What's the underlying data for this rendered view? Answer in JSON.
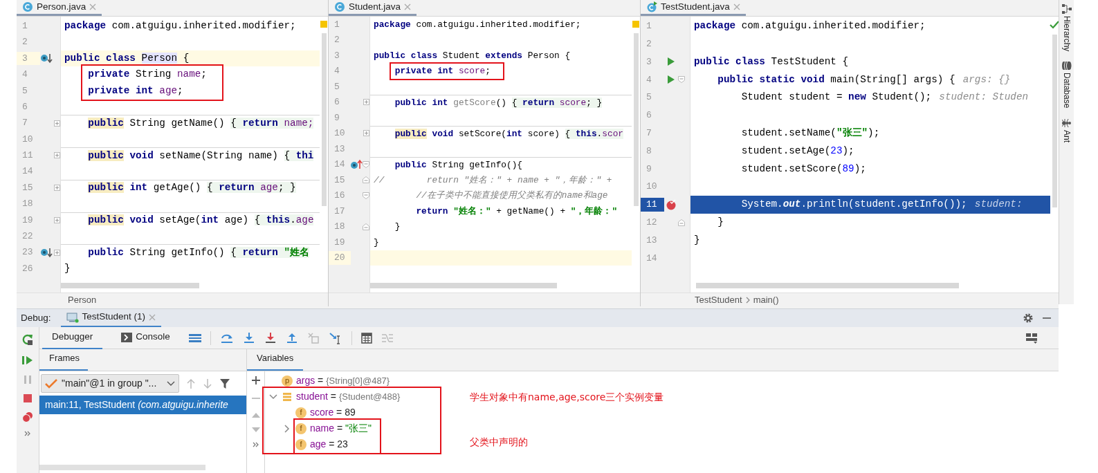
{
  "editors": [
    {
      "tab": {
        "label": "Person.java",
        "kind": "class",
        "selected": true
      },
      "warnings": true,
      "breadcrumbs": [
        "Person"
      ],
      "lines": [
        {
          "number": "1",
          "tokens": [
            {
              "kind": "keyword",
              "text": "package"
            },
            {
              "kind": "plain",
              "text": " com.atguigu.inherited.modifier;"
            }
          ]
        },
        {
          "number": "2"
        },
        {
          "number": "3",
          "current": true,
          "overridden": true,
          "tokens": [
            {
              "kind": "keyword",
              "text": "public class "
            },
            {
              "kind": "plain",
              "text": "Person",
              "identifier": true
            },
            {
              "kind": "plain",
              "text": " {"
            }
          ]
        },
        {
          "number": "4",
          "boxed": true,
          "tokens": [
            {
              "kind": "keyword",
              "text": "    private "
            },
            {
              "kind": "plain",
              "text": "String "
            },
            {
              "kind": "field",
              "text": "name"
            },
            {
              "kind": "plain",
              "text": ";"
            }
          ]
        },
        {
          "number": "5",
          "boxed": true,
          "tokens": [
            {
              "kind": "keyword",
              "text": "    private int "
            },
            {
              "kind": "field",
              "text": "age"
            },
            {
              "kind": "plain",
              "text": ";"
            }
          ]
        },
        {
          "number": "6"
        },
        {
          "number": "7",
          "separator": true,
          "collapsed": true,
          "tokens": [
            {
              "kind": "keyword",
              "text": "    public",
              "usage": true
            },
            {
              "kind": "plain",
              "text": " String getName() "
            },
            {
              "kind": "plain",
              "text": "{ ",
              "folded": true
            },
            {
              "kind": "keyword",
              "text": "return ",
              "folded": true
            },
            {
              "kind": "field",
              "text": "name;",
              "folded": true
            }
          ]
        },
        {
          "number": "10"
        },
        {
          "number": "11",
          "separator": true,
          "collapsed": true,
          "tokens": [
            {
              "kind": "keyword",
              "text": "    public",
              "usage": true
            },
            {
              "kind": "keyword",
              "text": " void"
            },
            {
              "kind": "plain",
              "text": " setName(String name) "
            },
            {
              "kind": "plain",
              "text": "{ ",
              "folded": true
            },
            {
              "kind": "keyword",
              "text": "thi",
              "folded": true
            }
          ]
        },
        {
          "number": "14"
        },
        {
          "number": "15",
          "separator": true,
          "collapsed": true,
          "tokens": [
            {
              "kind": "keyword",
              "text": "    public",
              "usage": true
            },
            {
              "kind": "keyword",
              "text": " int"
            },
            {
              "kind": "plain",
              "text": " getAge() "
            },
            {
              "kind": "plain",
              "text": "{ ",
              "folded": true
            },
            {
              "kind": "keyword",
              "text": "return ",
              "folded": true
            },
            {
              "kind": "field",
              "text": "age",
              "folded": true
            },
            {
              "kind": "plain",
              "text": "; }",
              "folded": true
            }
          ]
        },
        {
          "number": "18"
        },
        {
          "number": "19",
          "separator": true,
          "collapsed": true,
          "tokens": [
            {
              "kind": "keyword",
              "text": "    public",
              "usage": true
            },
            {
              "kind": "keyword",
              "text": " void"
            },
            {
              "kind": "plain",
              "text": " setAge("
            },
            {
              "kind": "keyword",
              "text": "int"
            },
            {
              "kind": "plain",
              "text": " age) "
            },
            {
              "kind": "plain",
              "text": "{ ",
              "folded": true
            },
            {
              "kind": "keyword",
              "text": "this",
              "folded": true
            },
            {
              "kind": "plain",
              "text": ".",
              "folded": true
            },
            {
              "kind": "field",
              "text": "age",
              "folded": true
            }
          ]
        },
        {
          "number": "22"
        },
        {
          "number": "23",
          "separator": true,
          "collapsed": true,
          "overridden": true,
          "tokens": [
            {
              "kind": "keyword",
              "text": "    public"
            },
            {
              "kind": "plain",
              "text": " String getInfo() "
            },
            {
              "kind": "plain",
              "text": "{ ",
              "folded": true
            },
            {
              "kind": "keyword",
              "text": "return ",
              "folded": true
            },
            {
              "kind": "string",
              "text": "\"姓名",
              "folded": true
            }
          ]
        },
        {
          "number": "26",
          "tokens": [
            {
              "kind": "plain",
              "text": "}"
            }
          ]
        }
      ]
    },
    {
      "tab": {
        "label": "Student.java",
        "kind": "class",
        "selected": true
      },
      "warnings": true,
      "lines": [
        {
          "number": "1",
          "tokens": [
            {
              "kind": "keyword",
              "text": "package"
            },
            {
              "kind": "plain",
              "text": " com.atguigu.inherited.modifier;"
            }
          ]
        },
        {
          "number": "2"
        },
        {
          "number": "3",
          "tokens": [
            {
              "kind": "keyword",
              "text": "public class "
            },
            {
              "kind": "plain",
              "text": "Student "
            },
            {
              "kind": "keyword",
              "text": "extends "
            },
            {
              "kind": "plain",
              "text": "Person {"
            }
          ]
        },
        {
          "number": "4",
          "boxed": true,
          "tokens": [
            {
              "kind": "keyword",
              "text": "    private int "
            },
            {
              "kind": "field",
              "text": "score"
            },
            {
              "kind": "plain",
              "text": ";"
            }
          ]
        },
        {
          "number": "5"
        },
        {
          "number": "6",
          "separator": true,
          "collapsed": true,
          "tokens": [
            {
              "kind": "keyword",
              "text": "    public int "
            },
            {
              "kind": "unused",
              "text": "getScore"
            },
            {
              "kind": "plain",
              "text": "() "
            },
            {
              "kind": "plain",
              "text": "{ ",
              "folded": true
            },
            {
              "kind": "keyword",
              "text": "return ",
              "folded": true
            },
            {
              "kind": "field",
              "text": "score",
              "folded": true
            },
            {
              "kind": "plain",
              "text": "; }",
              "folded": true
            }
          ]
        },
        {
          "number": "9"
        },
        {
          "number": "10",
          "separator": true,
          "collapsed": true,
          "tokens": [
            {
              "kind": "keyword",
              "text": "    public",
              "usage": true
            },
            {
              "kind": "keyword",
              "text": " void "
            },
            {
              "kind": "plain",
              "text": "setScore("
            },
            {
              "kind": "keyword",
              "text": "int"
            },
            {
              "kind": "plain",
              "text": " score) "
            },
            {
              "kind": "plain",
              "text": "{ ",
              "folded": true
            },
            {
              "kind": "keyword",
              "text": "this",
              "folded": true
            },
            {
              "kind": "plain",
              "text": ".",
              "folded": true
            },
            {
              "kind": "field",
              "text": "scor",
              "folded": true
            }
          ]
        },
        {
          "number": "13"
        },
        {
          "number": "14",
          "separator": true,
          "fold_start": true,
          "overrides": true,
          "tokens": [
            {
              "kind": "keyword",
              "text": "    public "
            },
            {
              "kind": "plain",
              "text": "String getInfo(){"
            }
          ]
        },
        {
          "number": "15",
          "fold_end": true,
          "tokens": [
            {
              "kind": "comment",
              "text": "//        return \"姓名：\" + name + \"，年龄：\" +"
            }
          ]
        },
        {
          "number": "16",
          "fold_start": true,
          "tokens": [
            {
              "kind": "comment",
              "text": "        //在子类中不能直接使用父类私有的name和age"
            }
          ]
        },
        {
          "number": "17",
          "tokens": [
            {
              "kind": "keyword",
              "text": "        return "
            },
            {
              "kind": "string",
              "text": "\"姓名：\""
            },
            {
              "kind": "plain",
              "text": " + getName() + "
            },
            {
              "kind": "string",
              "text": "\"，年龄：\""
            }
          ]
        },
        {
          "number": "18",
          "fold_end": true,
          "tokens": [
            {
              "kind": "plain",
              "text": "    }"
            }
          ]
        },
        {
          "number": "19",
          "tokens": [
            {
              "kind": "plain",
              "text": "}"
            }
          ]
        },
        {
          "number": "20",
          "current": true
        }
      ]
    },
    {
      "tab": {
        "label": "TestStudent.java",
        "kind": "runnable",
        "selected": true
      },
      "warnings": false,
      "breadcrumbs": [
        "TestStudent",
        "main()"
      ],
      "lines": [
        {
          "number": "1",
          "tokens": [
            {
              "kind": "keyword",
              "text": "package"
            },
            {
              "kind": "plain",
              "text": " com.atguigu.inherited.modifier;"
            }
          ]
        },
        {
          "number": "2"
        },
        {
          "number": "3",
          "runnable": true,
          "tokens": [
            {
              "kind": "keyword",
              "text": "public class "
            },
            {
              "kind": "plain",
              "text": "TestStudent {"
            }
          ]
        },
        {
          "number": "4",
          "runnable": true,
          "fold_start": true,
          "tokens": [
            {
              "kind": "keyword",
              "text": "    public static void "
            },
            {
              "kind": "plain",
              "text": "main(String[] args) {"
            },
            {
              "kind": "hint",
              "text": "args: {}"
            }
          ]
        },
        {
          "number": "5",
          "tokens": [
            {
              "kind": "plain",
              "text": "        Student student = "
            },
            {
              "kind": "keyword",
              "text": "new "
            },
            {
              "kind": "plain",
              "text": "Student();"
            },
            {
              "kind": "hint",
              "text": "student: Studen"
            }
          ]
        },
        {
          "number": "6"
        },
        {
          "number": "7",
          "tokens": [
            {
              "kind": "plain",
              "text": "        student.setName("
            },
            {
              "kind": "string",
              "text": "\"张三\""
            },
            {
              "kind": "plain",
              "text": ");"
            }
          ]
        },
        {
          "number": "8",
          "tokens": [
            {
              "kind": "plain",
              "text": "        student.setAge("
            },
            {
              "kind": "number",
              "text": "23"
            },
            {
              "kind": "plain",
              "text": ");"
            }
          ]
        },
        {
          "number": "9",
          "tokens": [
            {
              "kind": "plain",
              "text": "        student.setScore("
            },
            {
              "kind": "number",
              "text": "89"
            },
            {
              "kind": "plain",
              "text": ");"
            }
          ]
        },
        {
          "number": "10"
        },
        {
          "number": "11",
          "execution_point": true,
          "breakpoint": true,
          "tokens": [
            {
              "kind": "plain",
              "text": "        System."
            },
            {
              "kind": "static",
              "text": "out"
            },
            {
              "kind": "plain",
              "text": ".println(student.getInfo());"
            },
            {
              "kind": "hint",
              "text": "student:"
            }
          ]
        },
        {
          "number": "12",
          "fold_end": true,
          "tokens": [
            {
              "kind": "plain",
              "text": "    }"
            }
          ]
        },
        {
          "number": "13",
          "tokens": [
            {
              "kind": "plain",
              "text": "}"
            }
          ]
        },
        {
          "number": "14"
        }
      ]
    }
  ],
  "tool_windows": [
    {
      "label": "Hierarchy",
      "kind": "hierarchy"
    },
    {
      "label": "Database",
      "kind": "database"
    },
    {
      "label": "Ant",
      "kind": "ant"
    }
  ],
  "debug": {
    "label": "Debug:",
    "tabs": [
      {
        "label": "TestStudent (1)",
        "selected": true
      }
    ],
    "view_tabs": [
      {
        "label": "Debugger",
        "selected": true
      },
      {
        "label": "Console",
        "selected": false
      }
    ],
    "frames": {
      "title": "Frames",
      "thread": "\"main\"@1 in group \"...",
      "items": [
        {
          "method": "main:11, TestStudent",
          "location": "(com.atguigu.inherite",
          "selected": true
        }
      ]
    },
    "variables": {
      "title": "Variables",
      "items": [
        {
          "name": "args",
          "badge": "p",
          "operator": "=",
          "value": "{String[0]@487}",
          "kind": "object"
        },
        {
          "name": "student",
          "operator": "=",
          "value": "{Student@488}",
          "kind": "object",
          "expanded": true,
          "boxed": true,
          "children": [
            {
              "name": "score",
              "badge": "f",
              "operator": "=",
              "value": "89",
              "kind": "number",
              "boxed": true
            },
            {
              "name": "name",
              "badge": "f",
              "operator": "=",
              "value": "\"张三\"",
              "kind": "string",
              "expanded": false,
              "boxed": true,
              "inner_boxed": true
            },
            {
              "name": "age",
              "badge": "f",
              "operator": "=",
              "value": "23",
              "kind": "number",
              "boxed": true,
              "inner_boxed": true
            }
          ]
        }
      ],
      "notes": [
        "学生对象中有name,age,score三个实例变量",
        "父类中声明的"
      ]
    }
  }
}
